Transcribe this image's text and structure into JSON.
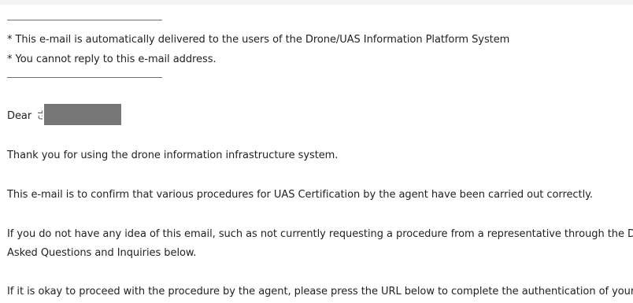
{
  "notice": {
    "line1": "* This e-mail is automatically delivered to the users of the Drone/UAS Information Platform System",
    "line2": "* You cannot reply to this e-mail address."
  },
  "greeting": {
    "prefix": "Dear",
    "name_fragment": "さ"
  },
  "body": {
    "thanks": "Thank you for using the drone information infrastructure system.",
    "confirm": "This e-mail is to confirm that various procedures for UAS Certification by the agent have been carried out correctly.",
    "idea_line1": "If you do not have any idea of this email, such as not currently requesting a procedure from a representative through the D",
    "idea_line2": "Asked Questions and Inquiries below.",
    "proceed": "If it is okay to proceed with the procedure by the agent, please press the URL below to complete the authentication of your"
  },
  "colors": {
    "background": "#f4f4f4",
    "sheet": "#ffffff",
    "text": "#222222",
    "redaction": "#777777"
  }
}
